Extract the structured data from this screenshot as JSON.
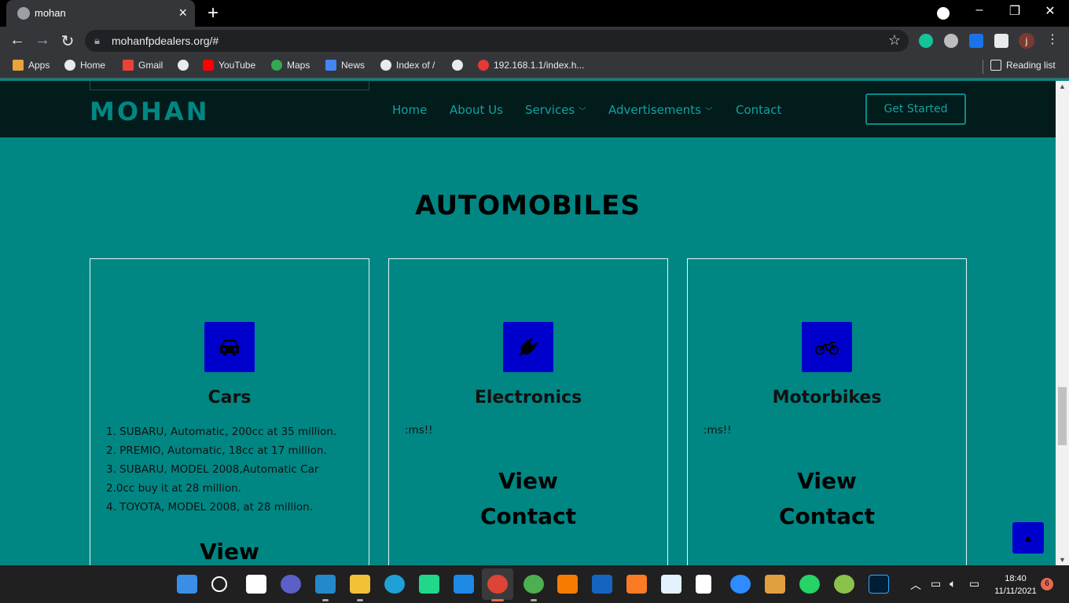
{
  "browser": {
    "tab_title": "mohan",
    "url": "mohanfpdealers.org/#",
    "profile_initial": "j",
    "bookmarks": [
      {
        "label": "Apps"
      },
      {
        "label": "Home"
      },
      {
        "label": "Gmail"
      },
      {
        "label": ""
      },
      {
        "label": "YouTube"
      },
      {
        "label": "Maps"
      },
      {
        "label": "News"
      },
      {
        "label": "Index of /"
      },
      {
        "label": ""
      },
      {
        "label": "192.168.1.1/index.h..."
      }
    ],
    "reading_list": "Reading list"
  },
  "site": {
    "logo": "MOHAN",
    "nav": {
      "home": "Home",
      "about": "About Us",
      "services": "Services",
      "ads": "Advertisements",
      "contact": "Contact"
    },
    "cta": "Get Started",
    "section_title": "AUTOMOBILES",
    "cards": [
      {
        "title": "Cars",
        "icon": "car-icon",
        "items": [
          "1. SUBARU, Automatic, 200cc at 35 million.",
          "2. PREMIO, Automatic, 18cc at 17 million.",
          "3. SUBARU, MODEL 2008,Automatic Car 2.0cc buy it at 28 million.",
          "4. TOYOTA, MODEL 2008, at 28 million."
        ],
        "link1": "View"
      },
      {
        "title": "Electronics",
        "icon": "plug-icon",
        "fragment": ":ms!!",
        "link1": "View",
        "link2": "Contact"
      },
      {
        "title": "Motorbikes",
        "icon": "motorbike-icon",
        "fragment": ":ms!!",
        "link1": "View",
        "link2": "Contact"
      }
    ]
  },
  "taskbar": {
    "time": "18:40",
    "date": "11/11/2021",
    "notifications": "6"
  },
  "colors": {
    "page_bg": "#008784",
    "header_bg": "#021b1b",
    "icon_bg": "#0000cc"
  }
}
